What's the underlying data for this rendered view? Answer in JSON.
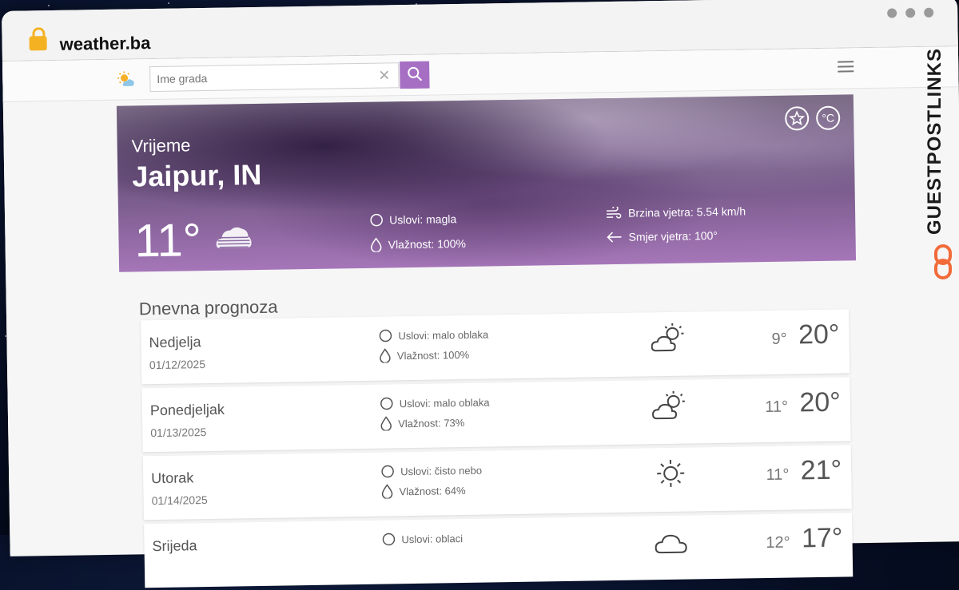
{
  "browser": {
    "url": "weather.ba"
  },
  "nav": {
    "search_placeholder": "Ime grada"
  },
  "hero": {
    "label": "Vrijeme",
    "city": "Jaipur, IN",
    "temperature": "11°",
    "unit_button": "°C",
    "conditions": "Uslovi: magla",
    "humidity": "Vlažnost: 100%",
    "wind_speed": "Brzina vjetra: 5.54 km/h",
    "wind_direction": "Smjer vjetra: 100°"
  },
  "forecast": {
    "title": "Dnevna prognoza",
    "days": [
      {
        "name": "Nedjelja",
        "date": "01/12/2025",
        "conditions": "Uslovi: malo oblaka",
        "humidity": "Vlažnost: 100%",
        "min": "9°",
        "max": "20°",
        "icon": "partly-cloudy-icon"
      },
      {
        "name": "Ponedjeljak",
        "date": "01/13/2025",
        "conditions": "Uslovi: malo oblaka",
        "humidity": "Vlažnost: 73%",
        "min": "11°",
        "max": "20°",
        "icon": "partly-cloudy-icon"
      },
      {
        "name": "Utorak",
        "date": "01/14/2025",
        "conditions": "Uslovi: čisto nebo",
        "humidity": "Vlažnost: 64%",
        "min": "11°",
        "max": "21°",
        "icon": "sun-icon"
      },
      {
        "name": "Srijeda",
        "date": "",
        "conditions": "Uslovi: oblaci",
        "humidity": "",
        "min": "12°",
        "max": "17°",
        "icon": "cloud-icon"
      }
    ]
  },
  "badge": {
    "text": "GUESTPOSTLINKS"
  },
  "colors": {
    "accent": "#a66fc4",
    "lock": "#f4b223",
    "badge_logo": "#f26b3a"
  }
}
